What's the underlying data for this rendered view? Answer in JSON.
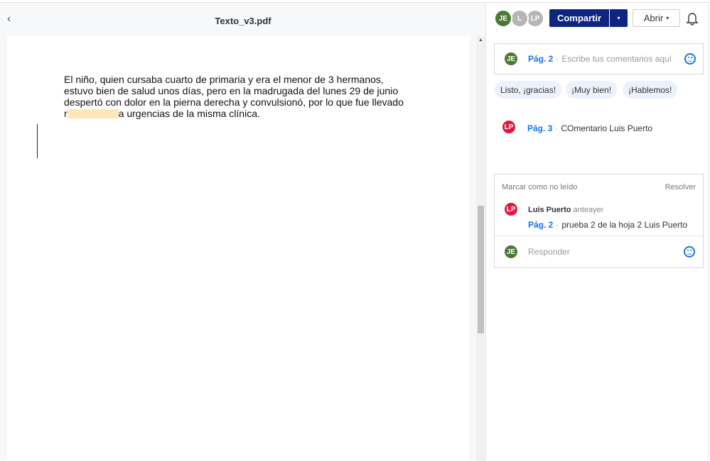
{
  "document": {
    "title": "Texto_v3.pdf",
    "back_icon": "‹",
    "paragraph_before": "El niño, quien cursaba cuarto de primaria y era el menor de 3 hermanos, estuvo bien de salud unos días, pero en la madrugada del lunes 29 de junio despertó con dolor en la pierna derecha y convulsionó, por lo que fue llevado r",
    "paragraph_after": "a urgencias de la misma clínica."
  },
  "header": {
    "avatars": [
      "JE",
      "L",
      "LP"
    ],
    "share_label": "Compartir",
    "share_dropdown": "▾",
    "open_label": "Abrir",
    "open_caret": "▾"
  },
  "composer": {
    "avatar": "JE",
    "page": "Pág. 2",
    "sep": "·",
    "placeholder": "Escribe tus comentarios aquí"
  },
  "quick_replies": [
    "Listo, ¡gracias!",
    "¡Muy bien!",
    "¡Hablemos!"
  ],
  "comment1": {
    "avatar": "LP",
    "page": "Pág. 3",
    "sep": "·",
    "text": "COmentario Luis Puerto"
  },
  "thread": {
    "mark_unread": "Marcar como no leído",
    "resolve": "Resolver",
    "avatar": "LP",
    "author": "Luis Puerto",
    "time": "anteayer",
    "page": "Pág. 2",
    "sep": "·",
    "text": "prueba 2 de la hoja 2 Luis Puerto",
    "reply_avatar": "JE",
    "reply_placeholder": "Responder"
  }
}
